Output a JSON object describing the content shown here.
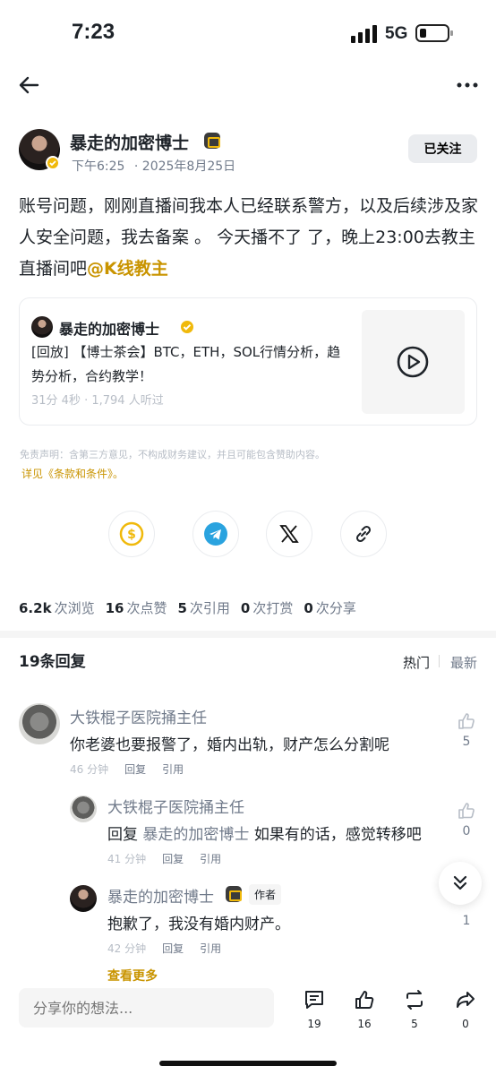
{
  "status_bar": {
    "time": "7:23",
    "network": "5G"
  },
  "post": {
    "author": "暴走的加密博士",
    "time": "下午6:25",
    "date": "· 2025年8月25日",
    "follow_label": "已关注",
    "text": "账号问题，刚刚直播间我本人已经联系警方，以及后续涉及家人安全问题，我去备案 。 今天播不了 了，晚上23:00去教主直播间吧",
    "mention": "@K线教主"
  },
  "live_card": {
    "host": "暴走的加密博士",
    "title": "[回放] 【博士茶会】BTC，ETH，SOL行情分析，趋势分析，合约教学！",
    "meta": "31分 4秒 · 1,794 人听过"
  },
  "disclaimer": "免责声明：含第三方意见，不构成财务建议，并且可能包含赞助内容。",
  "terms_link": "详见《条款和条件》。",
  "share_icons": [
    "tip-coin-icon",
    "telegram-icon",
    "x-icon",
    "link-icon"
  ],
  "stats": [
    {
      "value": "6.2k",
      "label": "次浏览"
    },
    {
      "value": "16",
      "label": "次点赞"
    },
    {
      "value": "5",
      "label": "次引用"
    },
    {
      "value": "0",
      "label": "次打赏"
    },
    {
      "value": "0",
      "label": "次分享"
    }
  ],
  "replies": {
    "title": "19条回复",
    "sort_hot": "热门",
    "sort_new": "最新",
    "items": [
      {
        "name": "大铁棍子医院捅主任",
        "text": "你老婆也要报警了，婚内出轨，财产怎么分割呢",
        "time": "46 分钟",
        "reply": "回复",
        "quote": "引用",
        "likes": "5"
      },
      {
        "name": "大铁棍子医院捅主任",
        "reply_prefix": "回复",
        "reply_to": "暴走的加密博士",
        "text": "如果有的话，感觉转移吧",
        "time": "41 分钟",
        "reply": "回复",
        "quote": "引用",
        "likes": "0"
      },
      {
        "name": "暴走的加密博士",
        "author_tag": "作者",
        "text": "抱歉了，我没有婚内财产。",
        "time": "42 分钟",
        "reply": "回复",
        "quote": "引用",
        "likes": "1"
      }
    ],
    "see_more": "查看更多"
  },
  "composer": {
    "placeholder": "分享你的想法..."
  },
  "actions": {
    "comments": "19",
    "likes": "16",
    "reposts": "5",
    "shares": "0"
  },
  "colors": {
    "accent": "#f0b90b",
    "link": "#c99400",
    "muted": "#707a8a"
  }
}
